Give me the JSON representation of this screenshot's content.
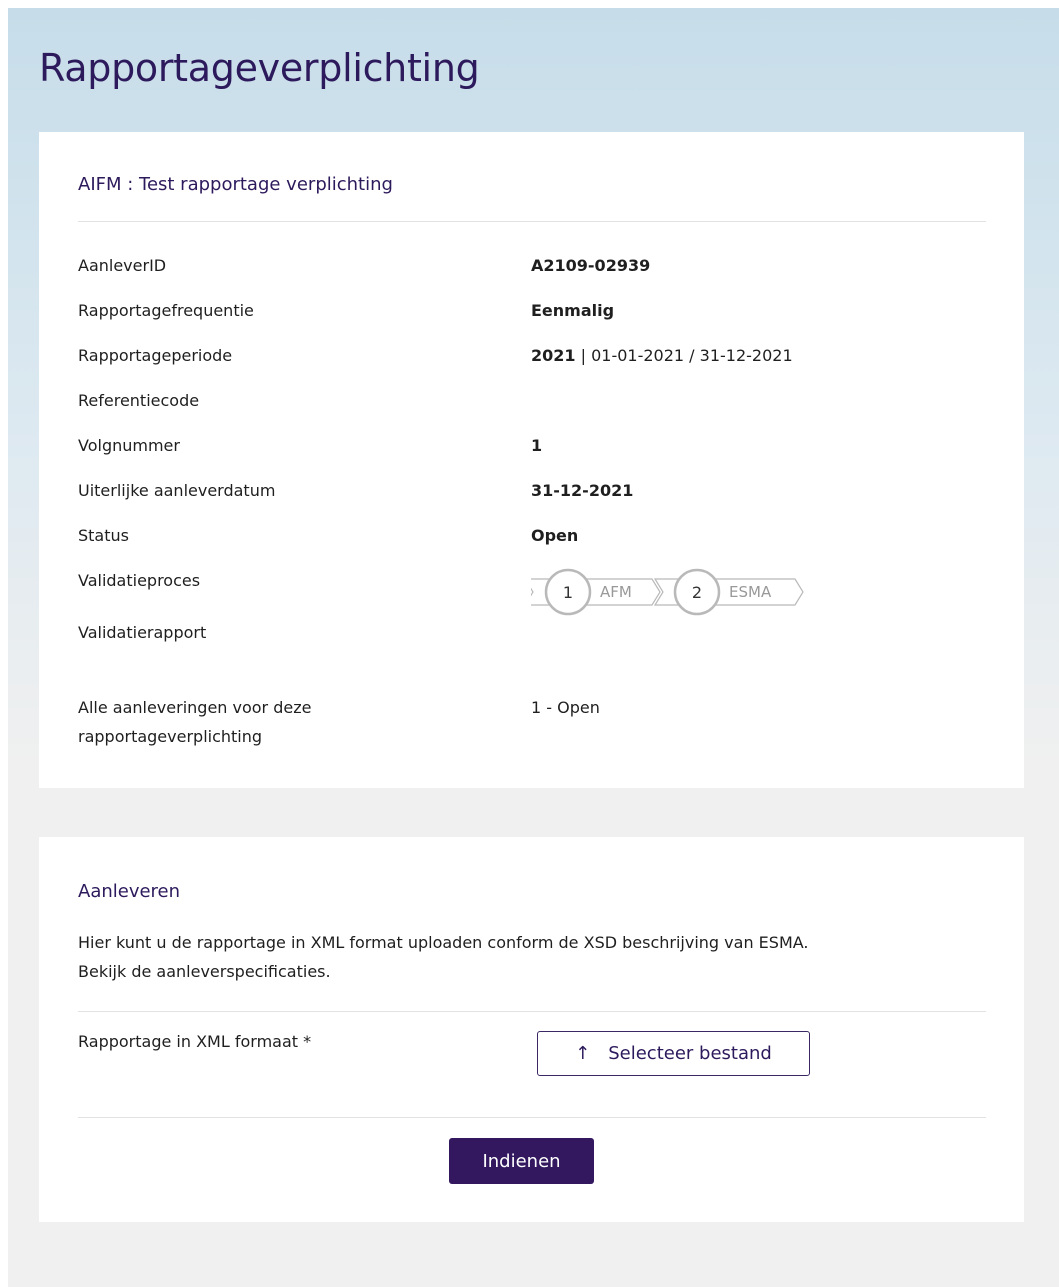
{
  "page": {
    "title": "Rapportageverplichting"
  },
  "details": {
    "title": "AIFM : Test rapportage verplichting",
    "rows": [
      {
        "label": "AanleverID",
        "value": "A2109-02939"
      },
      {
        "label": "Rapportagefrequentie",
        "value": "Eenmalig"
      },
      {
        "label": "Rapportageperiode",
        "value_bold": "2021",
        "value_rest": " | 01-01-2021 / 31-12-2021"
      },
      {
        "label": "Referentiecode",
        "value": ""
      },
      {
        "label": "Volgnummer",
        "value": "1"
      },
      {
        "label": "Uiterlijke aanleverdatum",
        "value": "31-12-2021"
      },
      {
        "label": "Status",
        "value": "Open"
      },
      {
        "label": "Validatieproces"
      },
      {
        "label": "Validatierapport",
        "value": ""
      },
      {
        "label": "Alle aanleveringen voor deze rapportageverplichting",
        "value": "1 - Open"
      }
    ],
    "validation_steps": [
      {
        "number": "1",
        "name": "AFM"
      },
      {
        "number": "2",
        "name": "ESMA"
      }
    ]
  },
  "upload": {
    "title": "Aanleveren",
    "intro_line1": "Hier kunt u de rapportage in XML format uploaden conform de XSD beschrijving van ESMA.",
    "intro_link": "Bekijk de aanleverspecificaties.",
    "file_label": "Rapportage in XML formaat *",
    "file_button": "Selecteer bestand",
    "upload_icon": "upload-arrow-icon",
    "submit_button": "Indienen"
  },
  "colors": {
    "brand": "#33185f",
    "title": "#2d1a5c",
    "background": "#f0f0f0"
  }
}
